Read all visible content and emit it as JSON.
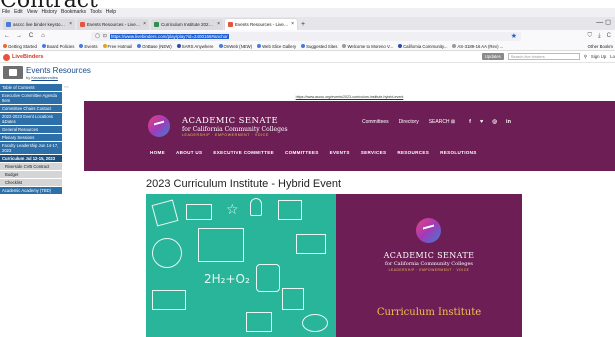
{
  "overlay_heading": "Contract",
  "menubar": [
    "File",
    "Edit",
    "View",
    "History",
    "Bookmarks",
    "Tools",
    "Help"
  ],
  "tabs": [
    {
      "label": "asccc live binder keystone - Se",
      "color": "#4a7ad8",
      "active": false
    },
    {
      "label": "Events Resources - LiveBinder",
      "color": "#e8533b",
      "active": false
    },
    {
      "label": "Curriculum Institute 2022 Succ",
      "color": "#2f8f4e",
      "active": false
    },
    {
      "label": "Events Resources - LiveBinder",
      "color": "#e8533b",
      "active": true
    }
  ],
  "newtab_symbol": "+",
  "window_controls": "—  ◻",
  "nav": {
    "back": "←",
    "forward": "→",
    "reload": "C",
    "home": "⌂",
    "shield": "◯",
    "lock": "⊡",
    "url": "https://www.livebinders.com/play/play?id=2400156#anchor",
    "star": "★"
  },
  "nav_right_icons": [
    "⛉",
    "⤓",
    "C"
  ],
  "bookmarks": [
    {
      "label": "Getting Started",
      "color": "#e86b2a"
    },
    {
      "label": "Board Policies",
      "color": "#4a7ad8"
    },
    {
      "label": "Events",
      "color": "#4a7ad8"
    },
    {
      "label": "Free Hotmail",
      "color": "#e0a32a"
    },
    {
      "label": "OnBase (NEW)",
      "color": "#4a7ad8"
    },
    {
      "label": "SARS Anywhere",
      "color": "#2b4fa3"
    },
    {
      "label": "OnWeb (NEW)",
      "color": "#4a7ad8"
    },
    {
      "label": "Web Slice Gallery",
      "color": "#4a7ad8"
    },
    {
      "label": "Suggested Sites",
      "color": "#4a7ad8"
    },
    {
      "label": "Welcome to Moreno V...",
      "color": "#999999"
    },
    {
      "label": "California Community...",
      "color": "#2b4fa3"
    },
    {
      "label": "AS-3189-16 AA (Rev) ...",
      "color": "#999999"
    }
  ],
  "bookmarks_right": "Other Bookm",
  "livebinders": {
    "logo": "LiveBinders",
    "updates": "Updates",
    "search_placeholder": "Search live binders",
    "signup": "Sign Up",
    "login": "Lo"
  },
  "binder": {
    "title": "Events Resources",
    "by_prefix": "by",
    "author": "Kmaddenmiles"
  },
  "sidebar": {
    "collapse": "<<",
    "items": [
      {
        "label": "Table of Contents",
        "type": "item"
      },
      {
        "label": "Executive Committee Agenda Item",
        "type": "item"
      },
      {
        "label": "Committee Chairs Contact",
        "type": "item"
      },
      {
        "label": "2022-2023 Event Locations &Dates",
        "type": "item"
      },
      {
        "label": "General Resources",
        "type": "item"
      },
      {
        "label": "Plenary Sessions",
        "type": "item"
      },
      {
        "label": "Faculty Leadership Jun 14-17, 2023",
        "type": "item"
      },
      {
        "label": "Curriculum Jul 12-15, 2023",
        "type": "active"
      },
      {
        "label": "Riverside CVB Contract",
        "type": "sub"
      },
      {
        "label": "Budget",
        "type": "sub"
      },
      {
        "label": "Checklist",
        "type": "sub"
      },
      {
        "label": "Academic Academy (TBD)",
        "type": "item"
      }
    ]
  },
  "content": {
    "page_url": "https://www.asccc.org/events/2023-curriculum-institute-hybrid-event",
    "site": {
      "name": "ACADEMIC SENATE",
      "sub": "for California Community Colleges",
      "tagline": "LEADERSHIP · EMPOWERMENT · VOICE",
      "top_links": [
        "Committees",
        "Directory",
        "SEARCH ⊠"
      ],
      "social": [
        "f",
        "♥",
        "◎",
        "in"
      ],
      "main_nav": [
        "HOME",
        "ABOUT US",
        "EXECUTIVE COMMITTEE",
        "COMMITTEES",
        "EVENTS",
        "SERVICES",
        "RESOURCES",
        "RESOLUTIONS"
      ]
    },
    "event_title": "2023 Curriculum Institute - Hybrid Event",
    "banner": {
      "formula": "2H₂+O₂",
      "name": "ACADEMIC SENATE",
      "sub": "for California Community Colleges",
      "tagline": "LEADERSHIP · EMPOWERMENT · VOICE",
      "headline": "Curriculum Institute"
    }
  }
}
